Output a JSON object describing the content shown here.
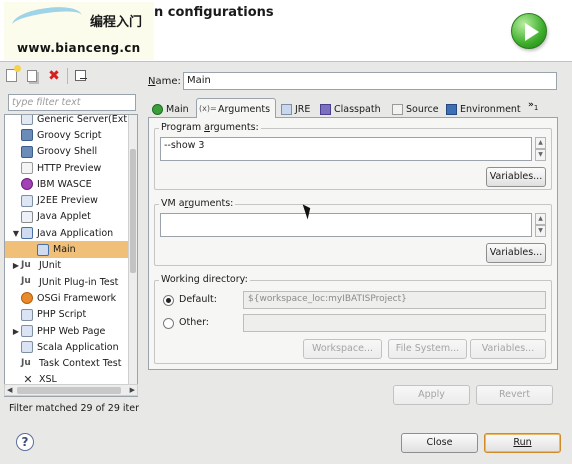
{
  "header": {
    "title": "n configurations",
    "watermark_cn": "编程入门",
    "watermark_url": "www.bianceng.cn"
  },
  "left": {
    "filter_placeholder": "type filter text",
    "tree": [
      {
        "label": "Generic Server(Ext",
        "icon": "server-icon",
        "indent": 1
      },
      {
        "label": "Groovy Script",
        "icon": "groovy-icon",
        "indent": 1
      },
      {
        "label": "Groovy Shell",
        "icon": "groovy-icon",
        "indent": 1
      },
      {
        "label": "HTTP Preview",
        "icon": "http-icon",
        "indent": 1
      },
      {
        "label": "IBM WASCE",
        "icon": "ibm-icon",
        "indent": 1
      },
      {
        "label": "J2EE Preview",
        "icon": "j2ee-icon",
        "indent": 1
      },
      {
        "label": "Java Applet",
        "icon": "applet-icon",
        "indent": 1
      },
      {
        "label": "Java Application",
        "icon": "java-app-icon",
        "indent": 0,
        "expanded": true
      },
      {
        "label": "Main",
        "icon": "java-app-icon",
        "indent": 2,
        "selected": true
      },
      {
        "label": "JUnit",
        "icon": "junit-icon",
        "indent": 0,
        "collapsed": true
      },
      {
        "label": "JUnit Plug-in Test",
        "icon": "junit-icon",
        "indent": 1
      },
      {
        "label": "OSGi Framework",
        "icon": "osgi-icon",
        "indent": 1
      },
      {
        "label": "PHP Script",
        "icon": "php-icon",
        "indent": 1
      },
      {
        "label": "PHP Web Page",
        "icon": "php-icon",
        "indent": 0,
        "collapsed": true
      },
      {
        "label": "Scala Application",
        "icon": "scala-icon",
        "indent": 1
      },
      {
        "label": "Task Context Test",
        "icon": "junit-icon",
        "indent": 1
      },
      {
        "label": "XSL",
        "icon": "xsl-icon",
        "indent": 1
      }
    ],
    "filter_status": "Filter matched 29 of 29 iter"
  },
  "name": {
    "label_pre": "N",
    "label_post": "ame:",
    "value": "Main"
  },
  "tabs": [
    {
      "label": "Main",
      "icon": "main-tab-icon"
    },
    {
      "label": "Arguments",
      "icon": "arguments-tab-icon",
      "active": true
    },
    {
      "label": "JRE",
      "icon": "jre-tab-icon"
    },
    {
      "label": "Classpath",
      "icon": "classpath-tab-icon"
    },
    {
      "label": "Source",
      "icon": "source-tab-icon"
    },
    {
      "label": "Environment",
      "icon": "environment-tab-icon"
    }
  ],
  "tab_overflow": {
    "label": "»",
    "count": "1"
  },
  "program_args": {
    "title_pre": "Program ",
    "title_u": "a",
    "title_post": "rguments:",
    "value": "--show 3",
    "variables": "Variables..."
  },
  "vm_args": {
    "title_pre": "VM a",
    "title_u": "r",
    "title_post": "guments:",
    "value": "",
    "variables": "Variables..."
  },
  "working_dir": {
    "title": "Working directory:",
    "default_label": "Default:",
    "default_value": "${workspace_loc:myIBATISProject}",
    "other_label": "Other:",
    "other_value": "",
    "workspace_btn": "Workspace...",
    "filesystem_btn": "File System...",
    "variables_btn": "Variables..."
  },
  "actions": {
    "apply": "Apply",
    "revert": "Revert",
    "close": "Close",
    "run": "Run"
  }
}
